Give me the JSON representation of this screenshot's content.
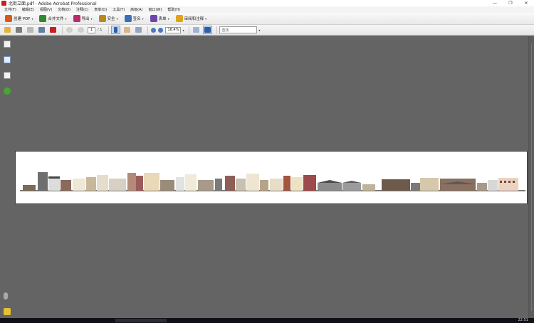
{
  "window": {
    "title": "北街立面.pdf - Adobe Acrobat Professional",
    "controls": {
      "minimize": "—",
      "maximize": "❐",
      "close": "✕"
    }
  },
  "menu": {
    "items": [
      "文件(F)",
      "编辑(E)",
      "视图(V)",
      "文档(D)",
      "注释(C)",
      "表单(O)",
      "工具(T)",
      "高级(A)",
      "窗口(W)",
      "帮助(H)"
    ]
  },
  "toolbar_tasks": [
    {
      "label": "创建 PDF",
      "icon": "create-pdf-icon",
      "color": "#d85a1a"
    },
    {
      "label": "合并文件",
      "icon": "combine-files-icon",
      "color": "#2f8a2f"
    },
    {
      "label": "导出",
      "icon": "export-icon",
      "color": "#b52d6e"
    },
    {
      "label": "安全",
      "icon": "security-lock-icon",
      "color": "#b88a1e"
    },
    {
      "label": "签名",
      "icon": "sign-pen-icon",
      "color": "#3b6fb5"
    },
    {
      "label": "表单",
      "icon": "forms-icon",
      "color": "#6d47a8"
    },
    {
      "label": "审阅和注释",
      "icon": "review-comment-icon",
      "color": "#e0a41a"
    }
  ],
  "navigation": {
    "current_page": "1",
    "total_pages": "/ 1",
    "zoom": "18.4%",
    "find_placeholder": "查找"
  },
  "colors": {
    "document_background": "#646464",
    "page_background": "#ffffff",
    "accent": "#c62020"
  },
  "status": {
    "clock": "22:51"
  }
}
